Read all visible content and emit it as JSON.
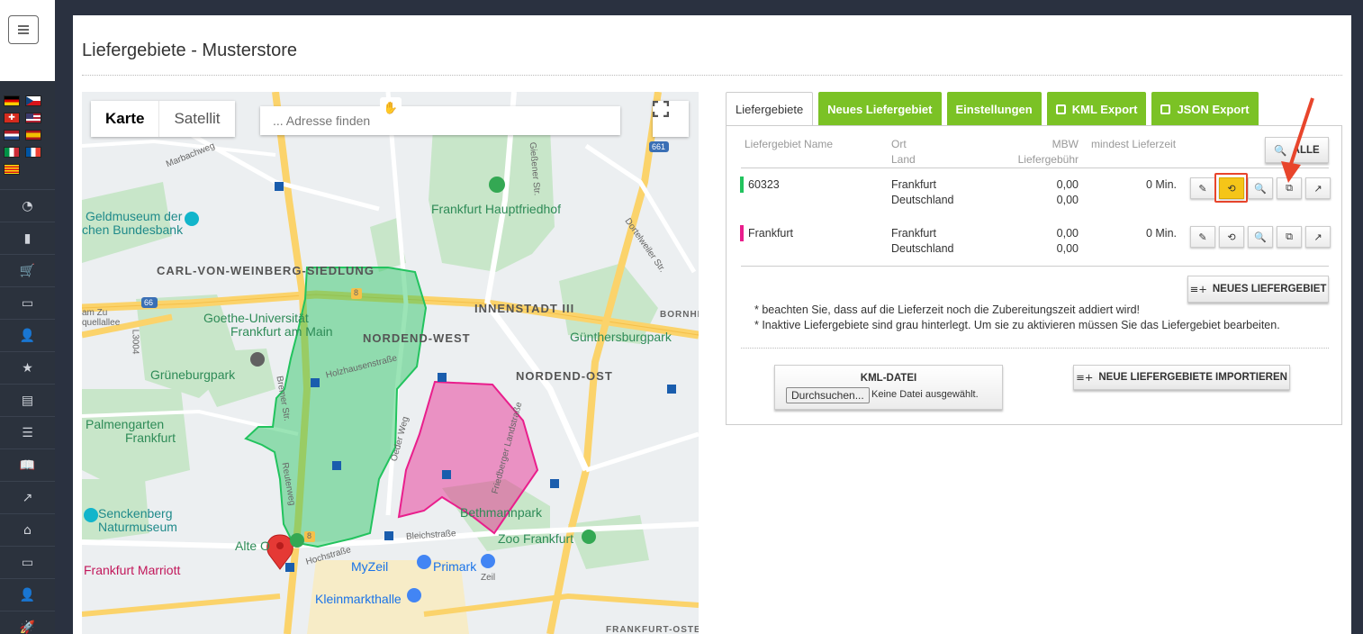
{
  "page": {
    "title": "Liefergebiete - Musterstore"
  },
  "sidebar": {
    "flags": [
      {
        "name": "germany-flag",
        "colors": [
          "#000000",
          "#dd0000",
          "#ffce00"
        ]
      },
      {
        "name": "czech-flag",
        "colors": [
          "#ffffff",
          "#d7141a",
          "#11457e"
        ]
      },
      {
        "name": "swiss-flag",
        "colors": [
          "#d52b1e",
          "#ffffff"
        ]
      },
      {
        "name": "us-flag",
        "colors": [
          "#b22234",
          "#ffffff",
          "#3c3b6e"
        ]
      },
      {
        "name": "netherlands-flag",
        "colors": [
          "#ae1c28",
          "#ffffff",
          "#21468b"
        ]
      },
      {
        "name": "spain-flag",
        "colors": [
          "#aa151b",
          "#f1bf00"
        ]
      },
      {
        "name": "italy-flag",
        "colors": [
          "#009246",
          "#ffffff",
          "#ce2b37"
        ]
      },
      {
        "name": "france-flag",
        "colors": [
          "#0055a4",
          "#ffffff",
          "#ef4135"
        ]
      },
      {
        "name": "catalonia-flag",
        "colors": [
          "#fcdd09",
          "#da121a"
        ]
      }
    ],
    "nav": [
      {
        "name": "dashboard-icon",
        "glyph": "◔"
      },
      {
        "name": "bar-chart-icon",
        "glyph": "▮"
      },
      {
        "name": "cart-icon",
        "glyph": "🛒"
      },
      {
        "name": "monitor-icon",
        "glyph": "▭"
      },
      {
        "name": "user-add-icon",
        "glyph": "👤"
      },
      {
        "name": "star-icon",
        "glyph": "★"
      },
      {
        "name": "archive-icon",
        "glyph": "▤"
      },
      {
        "name": "list-icon",
        "glyph": "☰"
      },
      {
        "name": "book-icon",
        "glyph": "📖"
      },
      {
        "name": "line-chart-icon",
        "glyph": "↗"
      },
      {
        "name": "home-icon",
        "glyph": "⌂"
      },
      {
        "name": "desktop-icon",
        "glyph": "▭"
      },
      {
        "name": "user-icon",
        "glyph": "👤"
      },
      {
        "name": "rocket-icon",
        "glyph": "🚀"
      }
    ]
  },
  "map": {
    "type_karte": "Karte",
    "type_satellit": "Satellit",
    "search_placeholder": "... Adresse finden",
    "labels": {
      "geldmuseum": "Geldmuseum der",
      "bundesbank": "chen Bundesbank",
      "hauptfriedhof": "Frankfurt Hauptfriedhof",
      "carl_von_weinberg": "CARL-VON-WEINBERG-SIEDLUNG",
      "goethe_uni": "Goethe-Universität",
      "goethe_uni2": "Frankfurt am Main",
      "innenstadt": "INNENSTADT III",
      "nordend_west": "NORDEND-WEST",
      "guenthersburgpark": "Günthersburgpark",
      "grueneburgpark": "Grüneburgpark",
      "nordend_ost": "NORDEND-OST",
      "palmengarten": "Palmengarten",
      "palmengarten2": "Frankfurt",
      "senckenberg": "Senckenberg",
      "senckenberg2": "Naturmuseum",
      "bethmannpark": "Bethmannpark",
      "zoo": "Zoo Frankfurt",
      "alte_oper": "Alte O",
      "marriott": "Frankfurt Marriott",
      "myzeil": "MyZeil",
      "primark": "Primark",
      "kleinmarkthalle": "Kleinmarkthalle",
      "bornheim": "BORNHE",
      "frankfurt_osten": "FRANKFURT-OSTEN",
      "marbachweg": "Marbachweg",
      "giessener_str": "Gießener Str.",
      "dortelweiler": "Dortelweiler Str.",
      "holzhausenstr": "Holzhausenstraße",
      "bremer_str": "Bremer Str.",
      "reuterweg": "Reuterweg",
      "oeder_weg": "Oeder Weg",
      "friedberger": "Friedberger Landstraße",
      "bleichstr": "Bleichstraße",
      "hochstr": "Hochstraße",
      "zeil": "Zeil",
      "road_661": "661",
      "road_66": "66",
      "road_l3004": "L3004",
      "am_zub": "am Zu",
      "quellallee": "quellallee",
      "road_8a": "8",
      "road_8b": "8"
    }
  },
  "tabs": [
    {
      "label": "Liefergebiete",
      "active": true
    },
    {
      "label": "Neues Liefergebiet",
      "active": false
    },
    {
      "label": "Einstellungen",
      "active": false
    },
    {
      "label": "KML Export",
      "active": false
    },
    {
      "label": "JSON Export",
      "active": false
    }
  ],
  "table": {
    "headers": {
      "name": "Liefergebiet Name",
      "ort": "Ort",
      "land": "Land",
      "mbw": "MBW",
      "gebuehr": "Liefergebühr",
      "lieferzeit": "mindest Lieferzeit"
    },
    "all_button": "ALLE",
    "rows": [
      {
        "name": "60323",
        "color": "#22c35e",
        "ort": "Frankfurt",
        "land": "Deutschland",
        "mbw": "0,00",
        "gebuehr": "0,00",
        "lieferzeit": "0 Min."
      },
      {
        "name": "Frankfurt",
        "color": "#e91e8c",
        "ort": "Frankfurt",
        "land": "Deutschland",
        "mbw": "0,00",
        "gebuehr": "0,00",
        "lieferzeit": "0 Min."
      }
    ]
  },
  "new_button": "NEUES LIEFERGEBIET",
  "notes": [
    "* beachten Sie, dass auf die Lieferzeit noch die Zubereitungszeit addiert wird!",
    "* Inaktive Liefergebiete sind grau hinterlegt. Um sie zu aktivieren müssen Sie das Liefergebiet bearbeiten."
  ],
  "kml": {
    "title": "KML-DATEI",
    "browse": "Durchsuchen...",
    "no_file": "Keine Datei ausgewählt."
  },
  "import_button": "NEUE LIEFERGEBIETE IMPORTIEREN",
  "colors": {
    "accent_green": "#7bc225",
    "highlight_yellow": "#f5c518",
    "annotation_red": "#e8452c"
  }
}
